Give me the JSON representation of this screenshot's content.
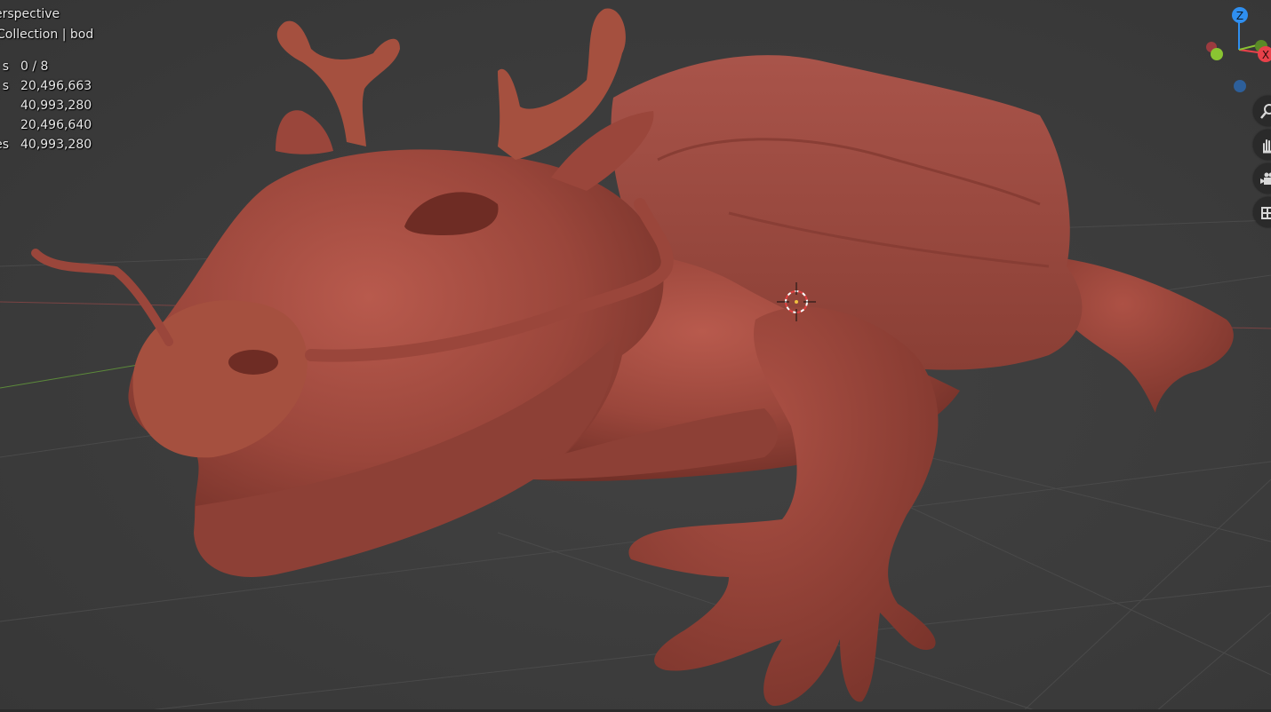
{
  "viewport": {
    "view_name": "erspective",
    "collection_line": "Collection | bod"
  },
  "stats": [
    {
      "label": "s",
      "value": "0 / 8"
    },
    {
      "label": "s",
      "value": "20,496,663"
    },
    {
      "label": "",
      "value": "40,993,280"
    },
    {
      "label": "",
      "value": "20,496,640"
    },
    {
      "label": "es",
      "value": "40,993,280"
    }
  ],
  "gizmo": {
    "z_label": "Z",
    "x_label": "X",
    "colors": {
      "x": "#e8414a",
      "y": "#8ac432",
      "z": "#2f8ff0",
      "neg_z": "#2d5f9a",
      "neg_x": "#9b3b3f"
    }
  },
  "nav_buttons": [
    {
      "name": "zoom-icon"
    },
    {
      "name": "hand-pan-icon"
    },
    {
      "name": "camera-icon"
    },
    {
      "name": "grid-ortho-icon"
    }
  ],
  "colors": {
    "background": "#3d3d3d",
    "model": "#9c4a3f",
    "cursor": "#e04040"
  }
}
